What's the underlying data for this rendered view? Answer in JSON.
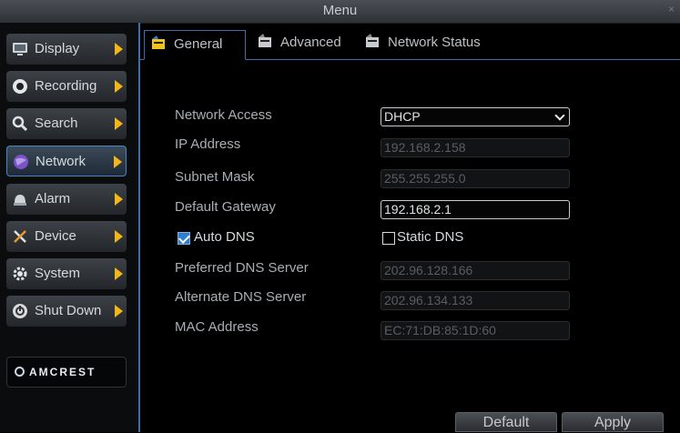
{
  "window": {
    "title": "Menu",
    "close_glyph": "×"
  },
  "sidebar": {
    "items": [
      {
        "label": "Display",
        "icon": "monitor-icon"
      },
      {
        "label": "Recording",
        "icon": "record-icon"
      },
      {
        "label": "Search",
        "icon": "search-icon"
      },
      {
        "label": "Network",
        "icon": "globe-icon",
        "active": true
      },
      {
        "label": "Alarm",
        "icon": "alarm-icon"
      },
      {
        "label": "Device",
        "icon": "tools-icon"
      },
      {
        "label": "System",
        "icon": "gear-icon"
      },
      {
        "label": "Shut Down",
        "icon": "power-icon"
      }
    ],
    "logo": "AMCREST"
  },
  "tabs": [
    {
      "label": "General",
      "active": true
    },
    {
      "label": "Advanced"
    },
    {
      "label": "Network Status"
    }
  ],
  "form": {
    "network_access": {
      "label": "Network Access",
      "value": "DHCP"
    },
    "ip_address": {
      "label": "IP Address",
      "value": "192.168.2.158"
    },
    "subnet_mask": {
      "label": "Subnet Mask",
      "value": "255.255.255.0"
    },
    "default_gateway": {
      "label": "Default Gateway",
      "value": "192.168.2.1"
    },
    "auto_dns": {
      "label": "Auto DNS",
      "checked": true
    },
    "static_dns": {
      "label": "Static DNS",
      "checked": false
    },
    "preferred_dns": {
      "label": "Preferred DNS Server",
      "value": "202.96.128.166"
    },
    "alternate_dns": {
      "label": "Alternate DNS Server",
      "value": "202.96.134.133"
    },
    "mac_address": {
      "label": "MAC Address",
      "value": "EC:71:DB:85:1D:60"
    }
  },
  "buttons": {
    "default": "Default",
    "apply": "Apply"
  },
  "colors": {
    "accent": "#3e6fa8",
    "arrow": "#f2b61b",
    "checkbox": "#2f7fd0"
  }
}
